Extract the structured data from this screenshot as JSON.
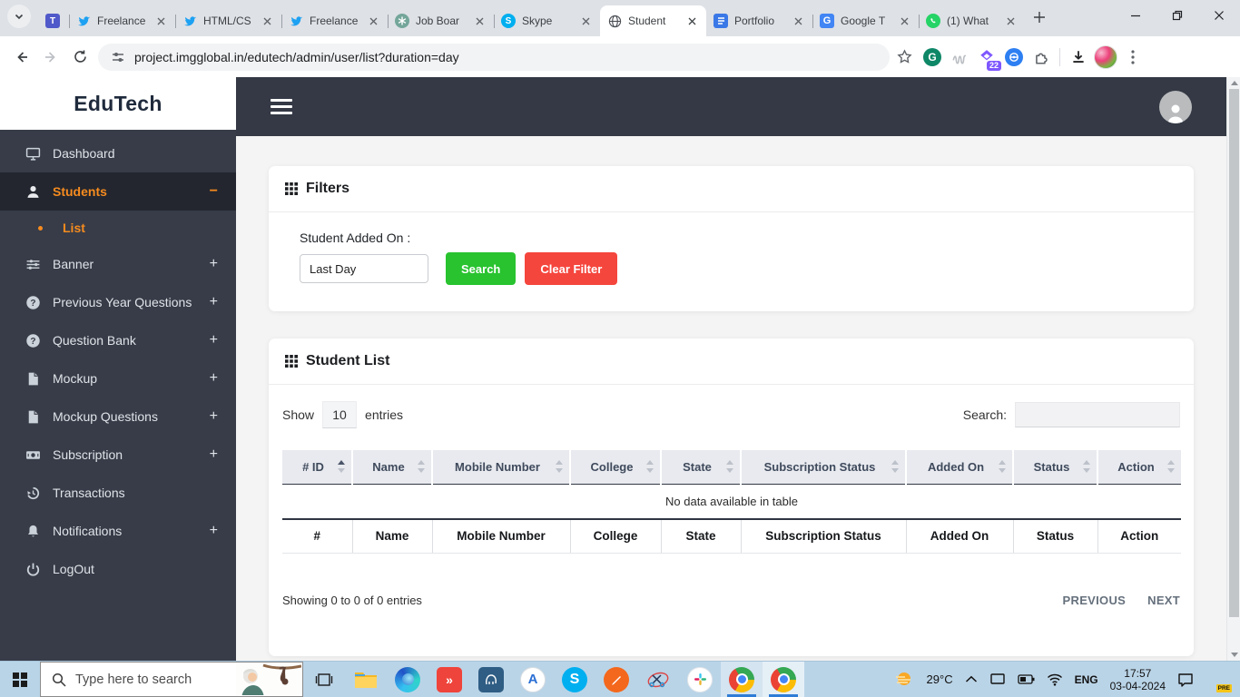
{
  "colors": {
    "accent_orange": "#f68b1f",
    "button_green": "#28c32f",
    "button_red": "#f5463d",
    "sidebar_bg": "#373c48",
    "sidebar_active_bg": "#23262e",
    "navbar_bg": "#343945",
    "taskbar_bg": "#bad4e7",
    "table_header_bg": "#e8eaef"
  },
  "browser": {
    "pinned_tab_icon": "teams-icon",
    "tabs": [
      {
        "title": "Freelance",
        "icon": "twitter-icon"
      },
      {
        "title": "HTML/CS",
        "icon": "twitter-icon"
      },
      {
        "title": "Freelance",
        "icon": "twitter-icon"
      },
      {
        "title": "Job Boar",
        "icon": "chatgpt-icon"
      },
      {
        "title": "Skype",
        "icon": "skype-icon"
      },
      {
        "title": "Student",
        "icon": "globe-icon",
        "active": true
      },
      {
        "title": "Portfolio",
        "icon": "docs-icon"
      },
      {
        "title": "Google T",
        "icon": "translate-icon"
      },
      {
        "title": "(1) What",
        "icon": "whatsapp-icon"
      }
    ],
    "new_tab_label": "+",
    "url": "project.imgglobal.in/edutech/admin/user/list?duration=day",
    "extension_badge_count": "22"
  },
  "sidebar": {
    "brand": "EduTech",
    "items": [
      {
        "label": "Dashboard",
        "icon": "monitor-icon",
        "toggle": ""
      },
      {
        "label": "Students",
        "icon": "user-icon",
        "toggle": "−",
        "active": true
      },
      {
        "label": "List",
        "icon": "bullet-dot",
        "sub": true
      },
      {
        "label": "Banner",
        "icon": "sliders-icon",
        "toggle": "+"
      },
      {
        "label": "Previous Year Questions",
        "icon": "question-circle-icon",
        "toggle": "+"
      },
      {
        "label": "Question Bank",
        "icon": "question-circle-icon",
        "toggle": "+"
      },
      {
        "label": "Mockup",
        "icon": "file-icon",
        "toggle": "+"
      },
      {
        "label": "Mockup Questions",
        "icon": "file-icon",
        "toggle": "+"
      },
      {
        "label": "Subscription",
        "icon": "cash-icon",
        "toggle": "+"
      },
      {
        "label": "Transactions",
        "icon": "history-icon",
        "toggle": ""
      },
      {
        "label": "Notifications",
        "icon": "bell-icon",
        "toggle": "+"
      },
      {
        "label": "LogOut",
        "icon": "power-icon",
        "toggle": ""
      }
    ]
  },
  "filters": {
    "title": "Filters",
    "label": "Student Added On :",
    "input_value": "Last Day",
    "search_button": "Search",
    "clear_button": "Clear Filter"
  },
  "student_list": {
    "title": "Student List",
    "show_label": "Show",
    "page_size": "10",
    "entries_label": "entries",
    "search_label": "Search:",
    "columns": [
      "# ID",
      "Name",
      "Mobile Number",
      "College",
      "State",
      "Subscription Status",
      "Added On",
      "Status",
      "Action"
    ],
    "footer_columns": [
      "#",
      "Name",
      "Mobile Number",
      "College",
      "State",
      "Subscription Status",
      "Added On",
      "Status",
      "Action"
    ],
    "empty_message": "No data available in table",
    "info": "Showing 0 to 0 of 0 entries",
    "prev_label": "PREVIOUS",
    "next_label": "NEXT"
  },
  "taskbar": {
    "search_placeholder": "Type here to search",
    "apps": [
      "task-view",
      "file-explorer",
      "edge",
      "anydesk",
      "pgadmin",
      "dev-tool",
      "skype",
      "pen-tool",
      "snipping-tool",
      "slack",
      "chrome",
      "chrome-active"
    ],
    "tray": {
      "temperature": "29°C",
      "language": "ENG",
      "time": "17:57",
      "date": "03-04-2024",
      "copilot_badge": "PRE"
    }
  }
}
